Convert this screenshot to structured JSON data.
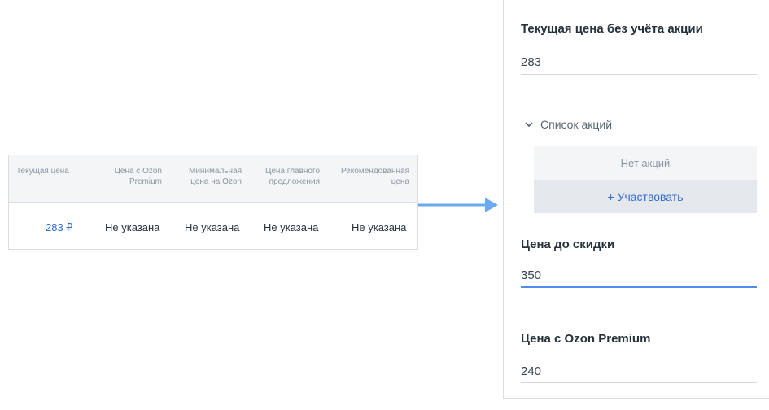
{
  "table": {
    "headers": [
      "Текущая цена",
      "Цена с Ozon Premium",
      "Минимальная цена на Ozon",
      "Цена главного предложения",
      "Рекомендованная цена"
    ],
    "row": [
      "283 ₽",
      "Не указана",
      "Не указана",
      "Не указана",
      "Не указана"
    ]
  },
  "panel": {
    "current_price": {
      "title": "Текущая цена без учёта акции",
      "value": "283"
    },
    "promos": {
      "toggle_label": "Список акций",
      "empty_text": "Нет акций",
      "participate_label": "+ Участвовать"
    },
    "price_before_discount": {
      "title": "Цена до скидки",
      "value": "350"
    },
    "premium_price": {
      "title": "Цена с Ozon Premium",
      "value": "240"
    }
  },
  "colors": {
    "accent": "#2d6bd6",
    "arrow": "#6aaaf0",
    "active_underline": "#4d8ce8",
    "header_bg": "#f3f5f7"
  },
  "icons": {
    "promo_toggle": "chevron-down-icon",
    "arrow": "arrow-right-icon"
  }
}
